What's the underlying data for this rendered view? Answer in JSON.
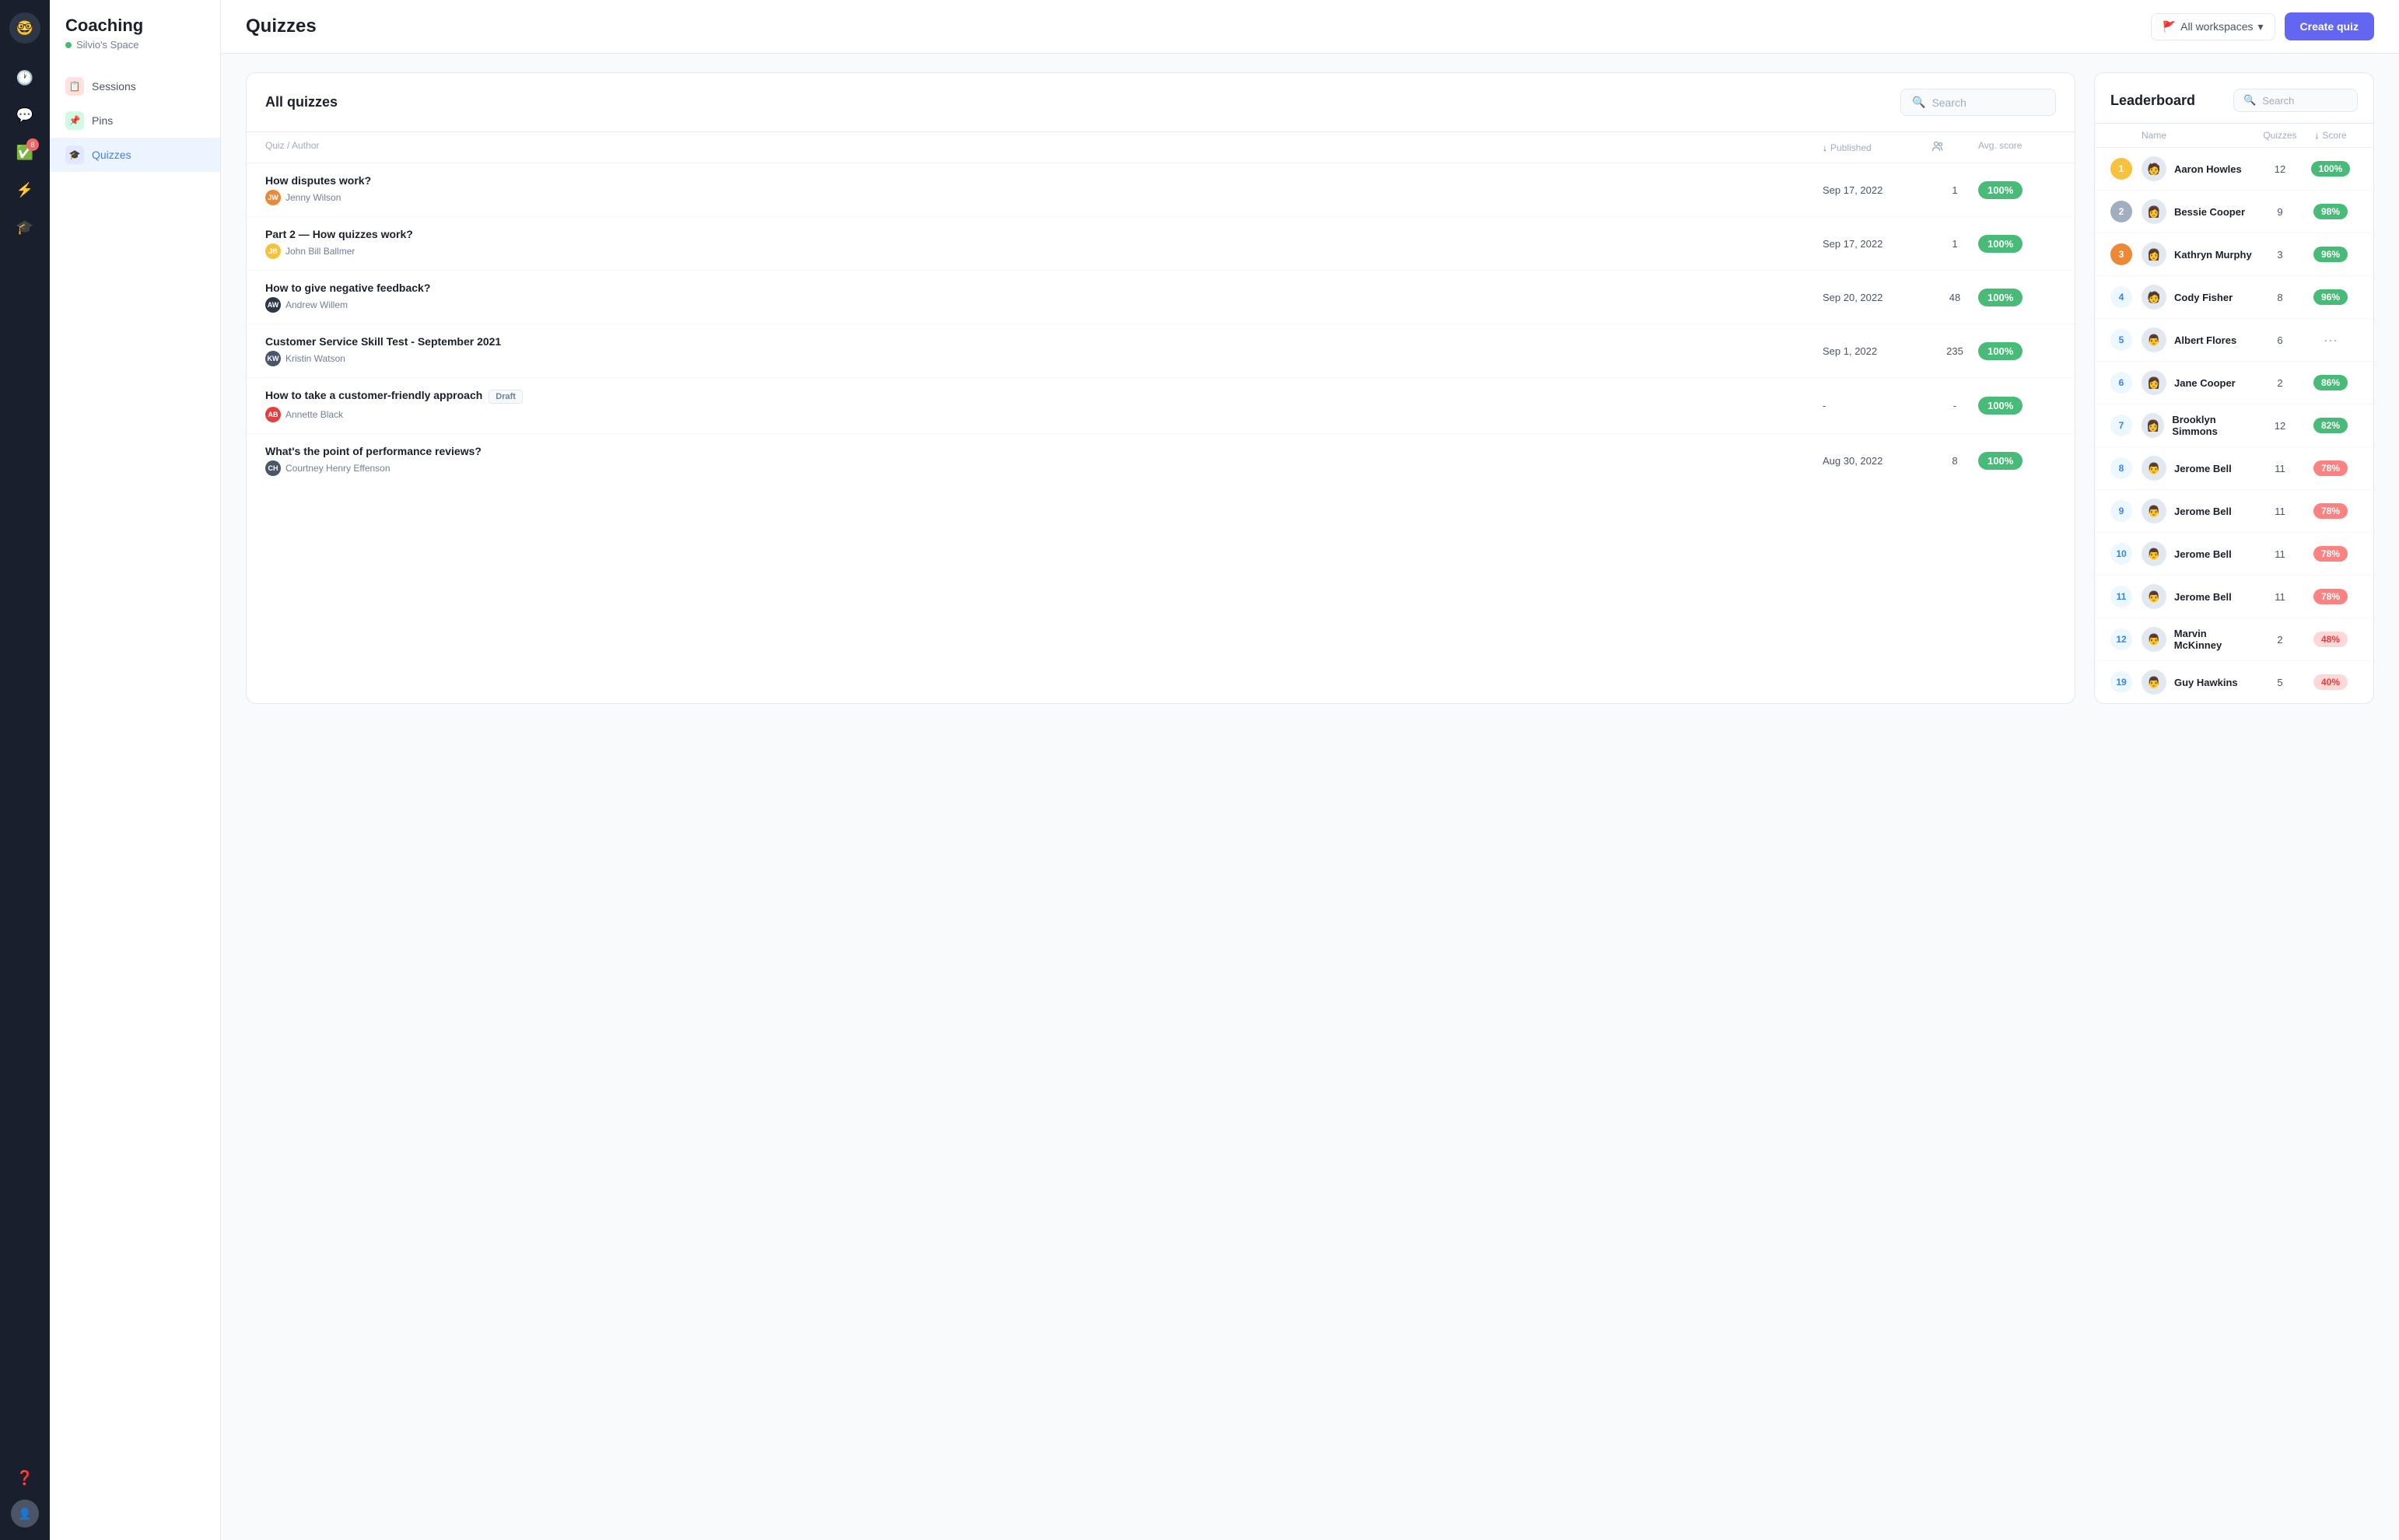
{
  "sidebar_dark": {
    "logo_emoji": "🤓",
    "nav_items": [
      {
        "id": "clock",
        "icon": "🕐",
        "active": false
      },
      {
        "id": "chat",
        "icon": "💬",
        "active": false
      },
      {
        "id": "tasks",
        "icon": "✅",
        "badge": "8",
        "active": false
      },
      {
        "id": "lightning",
        "icon": "⚡",
        "active": false
      },
      {
        "id": "graduation",
        "icon": "🎓",
        "active": true
      }
    ],
    "bottom_items": [
      {
        "id": "help",
        "icon": "❓"
      },
      {
        "id": "user",
        "icon": "👤"
      }
    ]
  },
  "left_nav": {
    "title": "Coaching",
    "workspace": "Silvio's Space",
    "items": [
      {
        "id": "sessions",
        "label": "Sessions",
        "icon": "📋",
        "icon_bg": "#fc8181",
        "active": false
      },
      {
        "id": "pins",
        "label": "Pins",
        "icon": "📌",
        "icon_bg": "#48bb78",
        "active": false
      },
      {
        "id": "quizzes",
        "label": "Quizzes",
        "icon": "🎓",
        "icon_bg": "#6366f1",
        "active": true
      }
    ]
  },
  "header": {
    "title": "Quizzes",
    "workspace_label": "All workspaces",
    "create_button": "Create quiz"
  },
  "quizzes_panel": {
    "title": "All quizzes",
    "search_placeholder": "Search",
    "columns": {
      "quiz_author": "Quiz / Author",
      "published": "Published",
      "participants": "",
      "avg_score": "Avg. score"
    },
    "rows": [
      {
        "name": "How disputes work?",
        "draft": false,
        "author": "Jenny Wilson",
        "author_color": "#ed8936",
        "author_initials": "JW",
        "date": "Sep 17, 2022",
        "participants": "1",
        "score": "100%",
        "score_color": "green"
      },
      {
        "name": "Part 2 — How quizzes work?",
        "draft": false,
        "author": "John Bill Ballmer",
        "author_color": "#f6c23e",
        "author_initials": "JB",
        "date": "Sep 17, 2022",
        "participants": "1",
        "score": "100%",
        "score_color": "green"
      },
      {
        "name": "How to give negative feedback?",
        "draft": false,
        "author": "Andrew Willem",
        "author_color": "#2d3748",
        "author_initials": "AW",
        "date": "Sep 20, 2022",
        "participants": "48",
        "score": "100%",
        "score_color": "green"
      },
      {
        "name": "Customer Service Skill Test - September 2021",
        "draft": false,
        "author": "Kristin Watson",
        "author_color": "#4a5568",
        "author_initials": "KW",
        "date": "Sep 1, 2022",
        "participants": "235",
        "score": "100%",
        "score_color": "green"
      },
      {
        "name": "How to take a customer-friendly approach",
        "draft": true,
        "author": "Annette Black",
        "author_color": "#e53e3e",
        "author_initials": "AB",
        "date": "-",
        "participants": "-",
        "score": "100%",
        "score_color": "green"
      },
      {
        "name": "What's the point of performance reviews?",
        "draft": false,
        "author": "Courtney Henry Effenson",
        "author_color": "#4a5568",
        "author_initials": "CH",
        "date": "Aug 30, 2022",
        "participants": "8",
        "score": "100%",
        "score_color": "green"
      }
    ]
  },
  "leaderboard": {
    "title": "Leaderboard",
    "search_placeholder": "Search",
    "columns": {
      "name": "Name",
      "quizzes": "Quizzes",
      "score": "Score"
    },
    "rows": [
      {
        "rank": 1,
        "rank_class": "gold",
        "name": "Aaron Howles",
        "quizzes": 12,
        "score": "100%",
        "score_class": "green",
        "emoji": "🧑"
      },
      {
        "rank": 2,
        "rank_class": "silver",
        "name": "Bessie Cooper",
        "quizzes": 9,
        "score": "98%",
        "score_class": "green",
        "emoji": "👩"
      },
      {
        "rank": 3,
        "rank_class": "bronze",
        "name": "Kathryn Murphy",
        "quizzes": 3,
        "score": "96%",
        "score_class": "green",
        "emoji": "👩"
      },
      {
        "rank": 4,
        "rank_class": "plain",
        "name": "Cody Fisher",
        "quizzes": 8,
        "score": "96%",
        "score_class": "green",
        "emoji": "🧑"
      },
      {
        "rank": 5,
        "rank_class": "plain",
        "name": "Albert Flores",
        "quizzes": 6,
        "score": "···",
        "score_class": "dots",
        "emoji": "👨"
      },
      {
        "rank": 6,
        "rank_class": "plain",
        "name": "Jane Cooper",
        "quizzes": 2,
        "score": "86%",
        "score_class": "green",
        "emoji": "👩"
      },
      {
        "rank": 7,
        "rank_class": "plain",
        "name": "Brooklyn Simmons",
        "quizzes": 12,
        "score": "82%",
        "score_class": "green",
        "emoji": "👩"
      },
      {
        "rank": 8,
        "rank_class": "plain",
        "name": "Jerome Bell",
        "quizzes": 11,
        "score": "78%",
        "score_class": "red",
        "emoji": "👨"
      },
      {
        "rank": 9,
        "rank_class": "plain",
        "name": "Jerome Bell",
        "quizzes": 11,
        "score": "78%",
        "score_class": "red",
        "emoji": "👨"
      },
      {
        "rank": 10,
        "rank_class": "plain",
        "name": "Jerome Bell",
        "quizzes": 11,
        "score": "78%",
        "score_class": "red",
        "emoji": "👨"
      },
      {
        "rank": 11,
        "rank_class": "plain",
        "name": "Jerome Bell",
        "quizzes": 11,
        "score": "78%",
        "score_class": "red",
        "emoji": "👨"
      },
      {
        "rank": 12,
        "rank_class": "plain",
        "name": "Marvin McKinney",
        "quizzes": 2,
        "score": "48%",
        "score_class": "pink",
        "emoji": "👨"
      },
      {
        "rank": 19,
        "rank_class": "plain",
        "name": "Guy Hawkins",
        "quizzes": 5,
        "score": "40%",
        "score_class": "pink",
        "emoji": "👨"
      }
    ]
  }
}
